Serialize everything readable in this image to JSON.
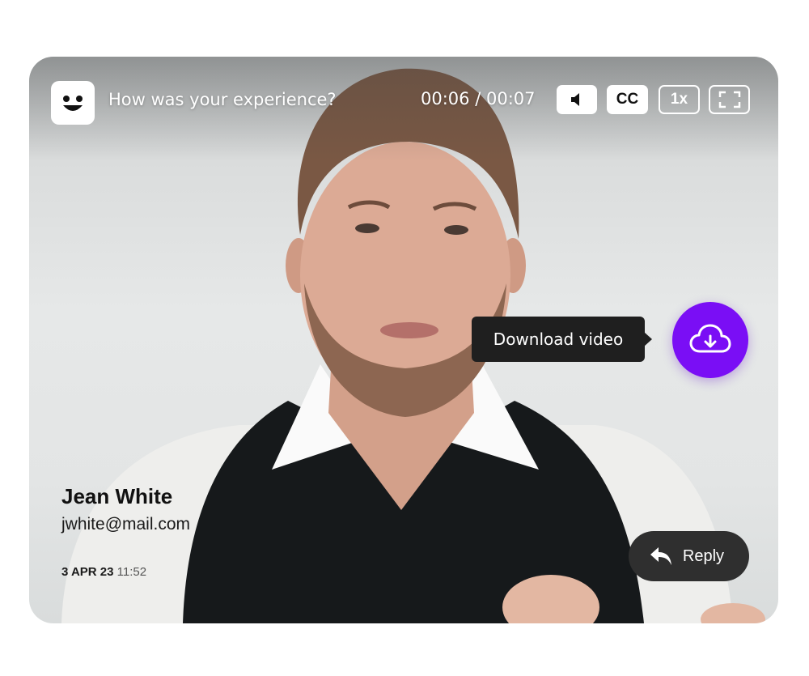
{
  "app": {
    "logo_icon": "smiley-face-icon",
    "question": "How was your experience?"
  },
  "player": {
    "time_current": "00:06",
    "time_separator": "/",
    "time_total": "00:07",
    "volume_icon": "speaker-icon",
    "cc_label": "CC",
    "speed_label": "1x",
    "fullscreen_icon": "fullscreen-icon"
  },
  "download": {
    "tooltip": "Download video",
    "icon": "cloud-download-icon",
    "color": "#7a0ef5"
  },
  "sender": {
    "name": "Jean White",
    "email": "jwhite@mail.com",
    "date": "3 APR 23",
    "time": "11:52"
  },
  "reply": {
    "label": "Reply",
    "icon": "reply-arrow-icon"
  }
}
